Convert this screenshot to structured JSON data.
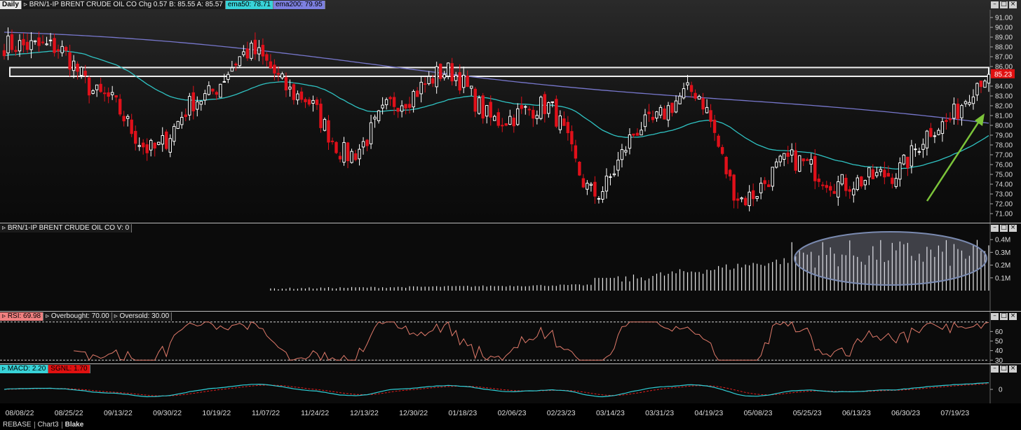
{
  "header": {
    "period": "Daily",
    "symbol": "BRN/1-IP  BRENT CRUDE OIL CO",
    "chg": "Chg 0.57",
    "bid": "B: 85.55",
    "ask": "A: 85.57",
    "ema50": "ema50: 78.71",
    "ema200": "ema200: 79.95"
  },
  "volume_header": "BRN/1-IP  BRENT CRUDE OIL CO  V: 0",
  "rsi_header": {
    "rsi": "RSI: 69.98",
    "overbought": "Overbought: 70.00",
    "oversold": "Oversold: 30.00"
  },
  "macd_header": {
    "macd": "MACD: 2.20",
    "signal": "SGNL: 1.70"
  },
  "status": {
    "mode": "REBASE",
    "chart": "Chart3",
    "user": "Blake"
  },
  "window_buttons": {
    "minimize": "–",
    "maximize": "□",
    "close": "×"
  },
  "colors": {
    "up": "#ffffff",
    "down": "#e0101a",
    "ema50": "#2fc2c2",
    "ema200": "#7777cc",
    "rsi": "#e07a6a",
    "macd": "#30d0d8",
    "signal": "#e02020",
    "arrow": "#7cc43a",
    "price_tag": "#e01010"
  },
  "chart_data": [
    {
      "type": "candlestick",
      "x_ticks": [
        "08/08/22",
        "08/25/22",
        "09/13/22",
        "09/30/22",
        "10/19/22",
        "11/07/22",
        "11/24/22",
        "12/13/22",
        "12/30/22",
        "01/18/23",
        "02/06/23",
        "02/23/23",
        "03/14/23",
        "03/31/23",
        "04/19/23",
        "05/08/23",
        "05/25/23",
        "06/13/23",
        "06/30/23",
        "07/19/23"
      ],
      "y_ticks": [
        "91.00",
        "90.00",
        "89.00",
        "88.00",
        "87.00",
        "86.00",
        "84.00",
        "83.00",
        "82.00",
        "81.00",
        "80.00",
        "79.00",
        "78.00",
        "77.00",
        "76.00",
        "75.00",
        "74.00",
        "73.00",
        "72.00",
        "71.00"
      ],
      "ylim": [
        70.5,
        91.5
      ],
      "last_price": "85.23",
      "key_close_points": [
        {
          "x": "08/08/22",
          "y": 88.2
        },
        {
          "x": "08/25/22",
          "y": 88.0
        },
        {
          "x": "09/13/22",
          "y": 83.0
        },
        {
          "x": "09/30/22",
          "y": 77.5
        },
        {
          "x": "10/19/22",
          "y": 82.8
        },
        {
          "x": "11/07/22",
          "y": 87.5
        },
        {
          "x": "11/24/22",
          "y": 83.0
        },
        {
          "x": "12/13/22",
          "y": 77.0
        },
        {
          "x": "12/30/22",
          "y": 82.5
        },
        {
          "x": "01/18/23",
          "y": 85.5
        },
        {
          "x": "02/06/23",
          "y": 80.5
        },
        {
          "x": "02/23/23",
          "y": 82.0
        },
        {
          "x": "03/14/23",
          "y": 73.0
        },
        {
          "x": "03/31/23",
          "y": 80.0
        },
        {
          "x": "04/19/23",
          "y": 83.5
        },
        {
          "x": "05/08/23",
          "y": 72.5
        },
        {
          "x": "05/25/23",
          "y": 76.5
        },
        {
          "x": "06/13/23",
          "y": 74.0
        },
        {
          "x": "06/30/23",
          "y": 75.0
        },
        {
          "x": "07/19/23",
          "y": 80.0
        },
        {
          "x": "07/28/23",
          "y": 85.2
        }
      ],
      "resistance_band": [
        85.0,
        85.9
      ],
      "series": [
        {
          "name": "ema50"
        },
        {
          "name": "ema200"
        }
      ]
    },
    {
      "type": "bar",
      "y_ticks": [
        "0.4M",
        "0.3M",
        "0.2M",
        "0.1M"
      ],
      "ylim": [
        0,
        0.45
      ]
    },
    {
      "type": "line",
      "y_ticks": [
        "60",
        "50",
        "40",
        "30"
      ],
      "ylim": [
        28,
        72
      ],
      "overbought": 70,
      "oversold": 30
    },
    {
      "type": "line",
      "y_ticks": [
        "0"
      ],
      "series": [
        {
          "name": "MACD"
        },
        {
          "name": "SGNL"
        }
      ]
    }
  ]
}
